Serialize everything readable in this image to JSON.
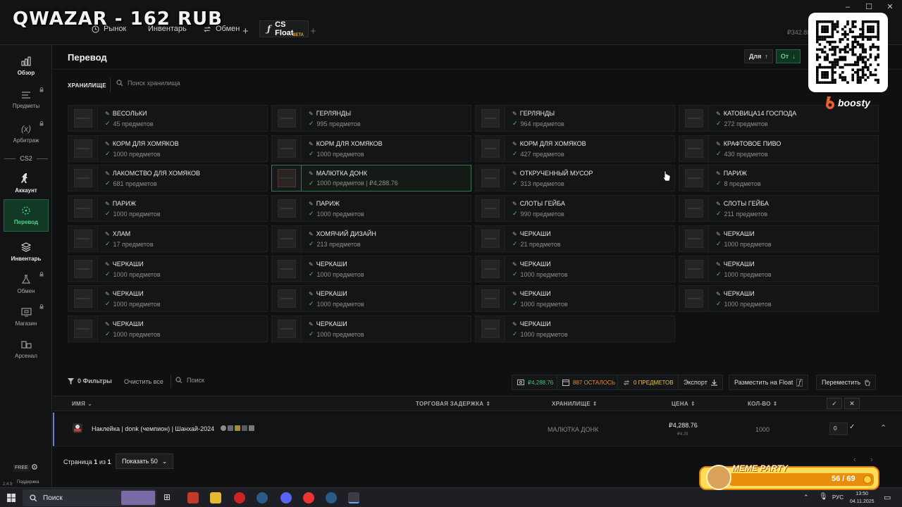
{
  "watermark": "QWAZAR - 162 RUB",
  "tabs": [
    {
      "label": "Рынок"
    },
    {
      "label": "Инвентарь"
    },
    {
      "label": "Обмен"
    },
    {
      "label": "CS Float",
      "badge": "BETA"
    }
  ],
  "top_balance": "₽342.88",
  "window_controls": [
    "–",
    "☐",
    "✕"
  ],
  "sidebar": {
    "items": [
      {
        "label": "Обзор",
        "icon": "chart-icon"
      },
      {
        "label": "Предметы",
        "icon": "list-icon"
      },
      {
        "label": "Арбитраж",
        "icon": "function-icon"
      },
      {
        "label": "Аккаунт",
        "icon": "counter-strike-icon"
      },
      {
        "label": "Перевод",
        "icon": "transfer-icon"
      },
      {
        "label": "Инвентарь",
        "icon": "layers-icon"
      },
      {
        "label": "Обмен",
        "icon": "flask-icon"
      },
      {
        "label": "Магазин",
        "icon": "store-icon"
      },
      {
        "label": "Арсенал",
        "icon": "arsenal-icon"
      }
    ],
    "section": "CS2",
    "plan": "FREE",
    "version": "2.4.9",
    "support": "Поддержка"
  },
  "page": {
    "title": "Перевод",
    "dir_for": "Для",
    "dir_from": "От"
  },
  "storage": {
    "label": "ХРАНИЛИЩЕ",
    "search_placeholder": "Поиск хранилища",
    "units": [
      {
        "name": "ВЕСОЛЬКИ",
        "count": "45 предметов"
      },
      {
        "name": "ГЕРЛЯНДЫ",
        "count": "995 предметов"
      },
      {
        "name": "ГЕРЛЯНДЫ",
        "count": "964 предметов"
      },
      {
        "name": "КАТОВИЦА14 ГОСПОДА",
        "count": "272 предметов"
      },
      {
        "name": "КОРМ ДЛЯ ХОМЯКОВ",
        "count": "1000 предметов"
      },
      {
        "name": "КОРМ ДЛЯ ХОМЯКОВ",
        "count": "1000 предметов"
      },
      {
        "name": "КОРМ ДЛЯ ХОМЯКОВ",
        "count": "427 предметов"
      },
      {
        "name": "КРАФТОВОЕ ПИВО",
        "count": "430 предметов"
      },
      {
        "name": "ЛАКОМСТВО ДЛЯ ХОМЯКОВ",
        "count": "681 предметов"
      },
      {
        "name": "МАЛЮТКА ДОНК",
        "count": "1000 предметов | ₽4,288.76",
        "selected": true
      },
      {
        "name": "ОТКРУЧЕННЫЙ МУСОР",
        "count": "313 предметов"
      },
      {
        "name": "ПАРИЖ",
        "count": "8 предметов"
      },
      {
        "name": "ПАРИЖ",
        "count": "1000 предметов"
      },
      {
        "name": "ПАРИЖ",
        "count": "1000 предметов"
      },
      {
        "name": "СЛОТЫ ГЕЙБА",
        "count": "990 предметов"
      },
      {
        "name": "СЛОТЫ ГЕЙБА",
        "count": "211 предметов"
      },
      {
        "name": "ХЛАМ",
        "count": "17 предметов"
      },
      {
        "name": "ХОМЯЧИЙ ДИЗАЙН",
        "count": "213 предметов"
      },
      {
        "name": "ЧЕРКАШИ",
        "count": "21 предметов"
      },
      {
        "name": "ЧЕРКАШИ",
        "count": "1000 предметов"
      },
      {
        "name": "ЧЕРКАШИ",
        "count": "1000 предметов"
      },
      {
        "name": "ЧЕРКАШИ",
        "count": "1000 предметов"
      },
      {
        "name": "ЧЕРКАШИ",
        "count": "1000 предметов"
      },
      {
        "name": "ЧЕРКАШИ",
        "count": "1000 предметов"
      },
      {
        "name": "ЧЕРКАШИ",
        "count": "1000 предметов"
      },
      {
        "name": "ЧЕРКАШИ",
        "count": "1000 предметов"
      },
      {
        "name": "ЧЕРКАШИ",
        "count": "1000 предметов"
      },
      {
        "name": "ЧЕРКАШИ",
        "count": "1000 предметов"
      },
      {
        "name": "ЧЕРКАШИ",
        "count": "1000 предметов"
      },
      {
        "name": "ЧЕРКАШИ",
        "count": "1000 предметов"
      },
      {
        "name": "ЧЕРКАШИ",
        "count": "1000 предметов"
      }
    ]
  },
  "toolbar": {
    "filters": "0 Фильтры",
    "clear_all": "Очистить все",
    "search_placeholder": "Поиск",
    "total_value": "₽4,288.76",
    "remaining": "887 ОСТАЛОСЬ",
    "selected": "0 ПРЕДМЕТОВ",
    "export": "Экспорт",
    "list_float": "Разместить на Float",
    "move": "Переместить",
    "colors": {
      "value": "#4bbf7b",
      "remaining": "#e38b3c",
      "selected": "#e5c14a"
    }
  },
  "table": {
    "headers": {
      "name": "ИМЯ",
      "delay": "ТОРГОВАЯ ЗАДЕРЖКА",
      "storage": "ХРАНИЛИЩЕ",
      "price": "ЦЕНА",
      "qty": "КОЛ-ВО"
    },
    "rows": [
      {
        "name": "Наклейка | donk (чемпион) | Шанхай-2024",
        "storage": "МАЛЮТКА ДОНК",
        "price": "₽4,288.76",
        "unit_price": "₽4.29",
        "qty": "1000",
        "input_qty": "0"
      }
    ]
  },
  "pagination": {
    "page_prefix": "Страница ",
    "page_current": "1",
    "page_of": " из ",
    "page_total": "1",
    "page_size": "Показать 50"
  },
  "taskbar": {
    "search": "Поиск",
    "lang": "РУС",
    "time": "13:50",
    "date": "04.11.2025"
  },
  "overlays": {
    "boosty": "boosty",
    "meme_title": "MEME PARTY",
    "meme_count": "56 / 69"
  }
}
